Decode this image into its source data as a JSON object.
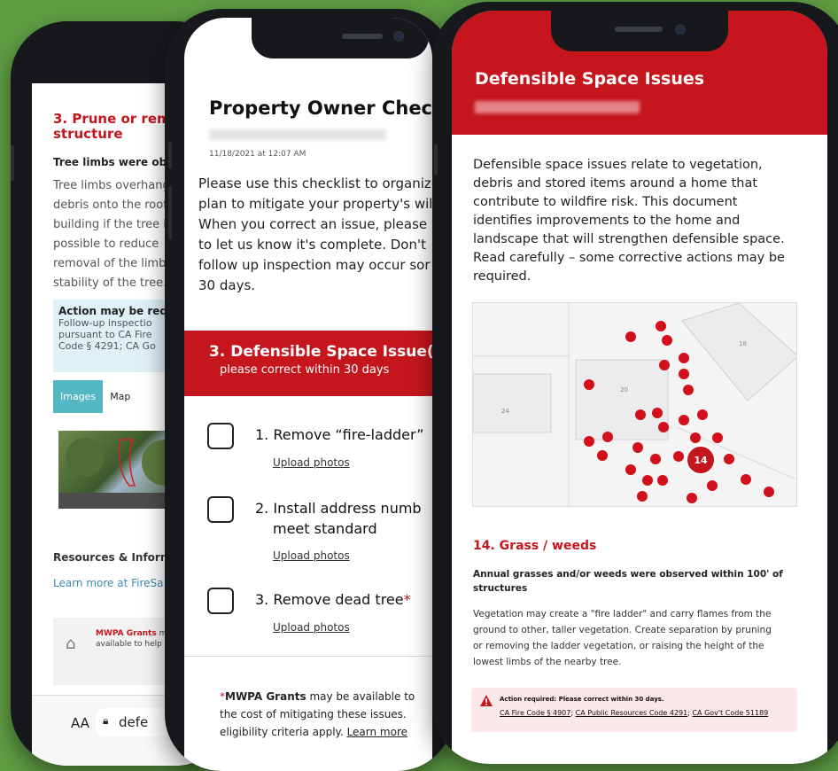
{
  "colors": {
    "background": "#5f9e44",
    "brand_red": "#c4161c",
    "tab_teal": "#56b7c4",
    "link_blue": "#3b8ab0"
  },
  "phone_left": {
    "section_title": "3. Prune or remove structure",
    "subtitle": "Tree limbs were ob",
    "body_lines": [
      "Tree limbs overhang",
      "debris onto the roof",
      "building if the tree i",
      "possible to reduce",
      "removal of the limb",
      "stability of the tree."
    ],
    "action_title": "Action may be requ",
    "action_lines": [
      "Follow-up inspectio",
      "pursuant to CA Fire",
      "Code § 4291; CA Go"
    ],
    "tab_images": "Images",
    "tab_map": "Map",
    "resources_heading": "Resources & Inform",
    "learn_more": "Learn more at FireSa",
    "grant_label": "MWPA Grants",
    "grant_text_1": "ma",
    "grant_text_2": "available to help",
    "grant_icon": "house-coin-icon",
    "browser_aa": "AA",
    "browser_url": "defe",
    "lock_icon": "lock-icon"
  },
  "phone_middle": {
    "title": "Property Owner Checklis",
    "timestamp": "11/18/2021 at 12:07 AM",
    "body_lines": [
      "Please use this checklist to organiz",
      "plan to mitigate your property's wil",
      "When you correct an issue, please",
      "to let us know it's complete. Don't",
      "follow up inspection may occur sor",
      "30 days."
    ],
    "banner_title": "3. Defensible Space Issue(s)",
    "banner_sub": "please correct within 30 days",
    "tasks": [
      {
        "lines": [
          "1. Remove “fire-ladder”"
        ],
        "asterisk": "",
        "upload": "Upload photos"
      },
      {
        "lines": [
          "2. Install address numb",
          "meet standard"
        ],
        "asterisk": "",
        "upload": "Upload photos"
      },
      {
        "lines": [
          "3. Remove dead tree"
        ],
        "asterisk": "*",
        "upload": "Upload photos"
      }
    ],
    "footer_asterisk": "*",
    "footer_bold": "MWPA Grants",
    "footer_text_1": " may be available to",
    "footer_text_2": "the cost of mitigating these issues.",
    "footer_text_3": "eligibility criteria apply. ",
    "footer_link": "Learn more"
  },
  "phone_right": {
    "header_title": "Defensible Space Issues",
    "intro_lines": [
      "Defensible space issues relate to vegetation,",
      "debris and stored items around a home that",
      "contribute to wildfire risk. This document",
      "identifies improvements to the home and",
      "landscape that will strengthen defensible space.",
      "Read carefully – some corrective actions may be",
      "required."
    ],
    "map": {
      "parcel_labels": [
        "18",
        "20",
        "24"
      ],
      "selected_marker": "14"
    },
    "section_title": "14. Grass / weeds",
    "observation_lines": [
      "Annual grasses and/or weeds were observed within 100' of",
      "structures"
    ],
    "description_lines": [
      "Vegetation may create a \"fire ladder\" and carry flames from the",
      "ground to other, taller vegetation. Create separation by pruning",
      "or removing the ladder vegetation, or raising the height of the",
      "lowest limbs of the nearby tree."
    ],
    "alert_title": "Action required: Please correct within 30 days.",
    "codes": [
      "CA Fire Code § 4907",
      "CA Public Resources Code 4291",
      "CA Gov't Code 51189"
    ],
    "alert_icon": "warning-icon"
  }
}
